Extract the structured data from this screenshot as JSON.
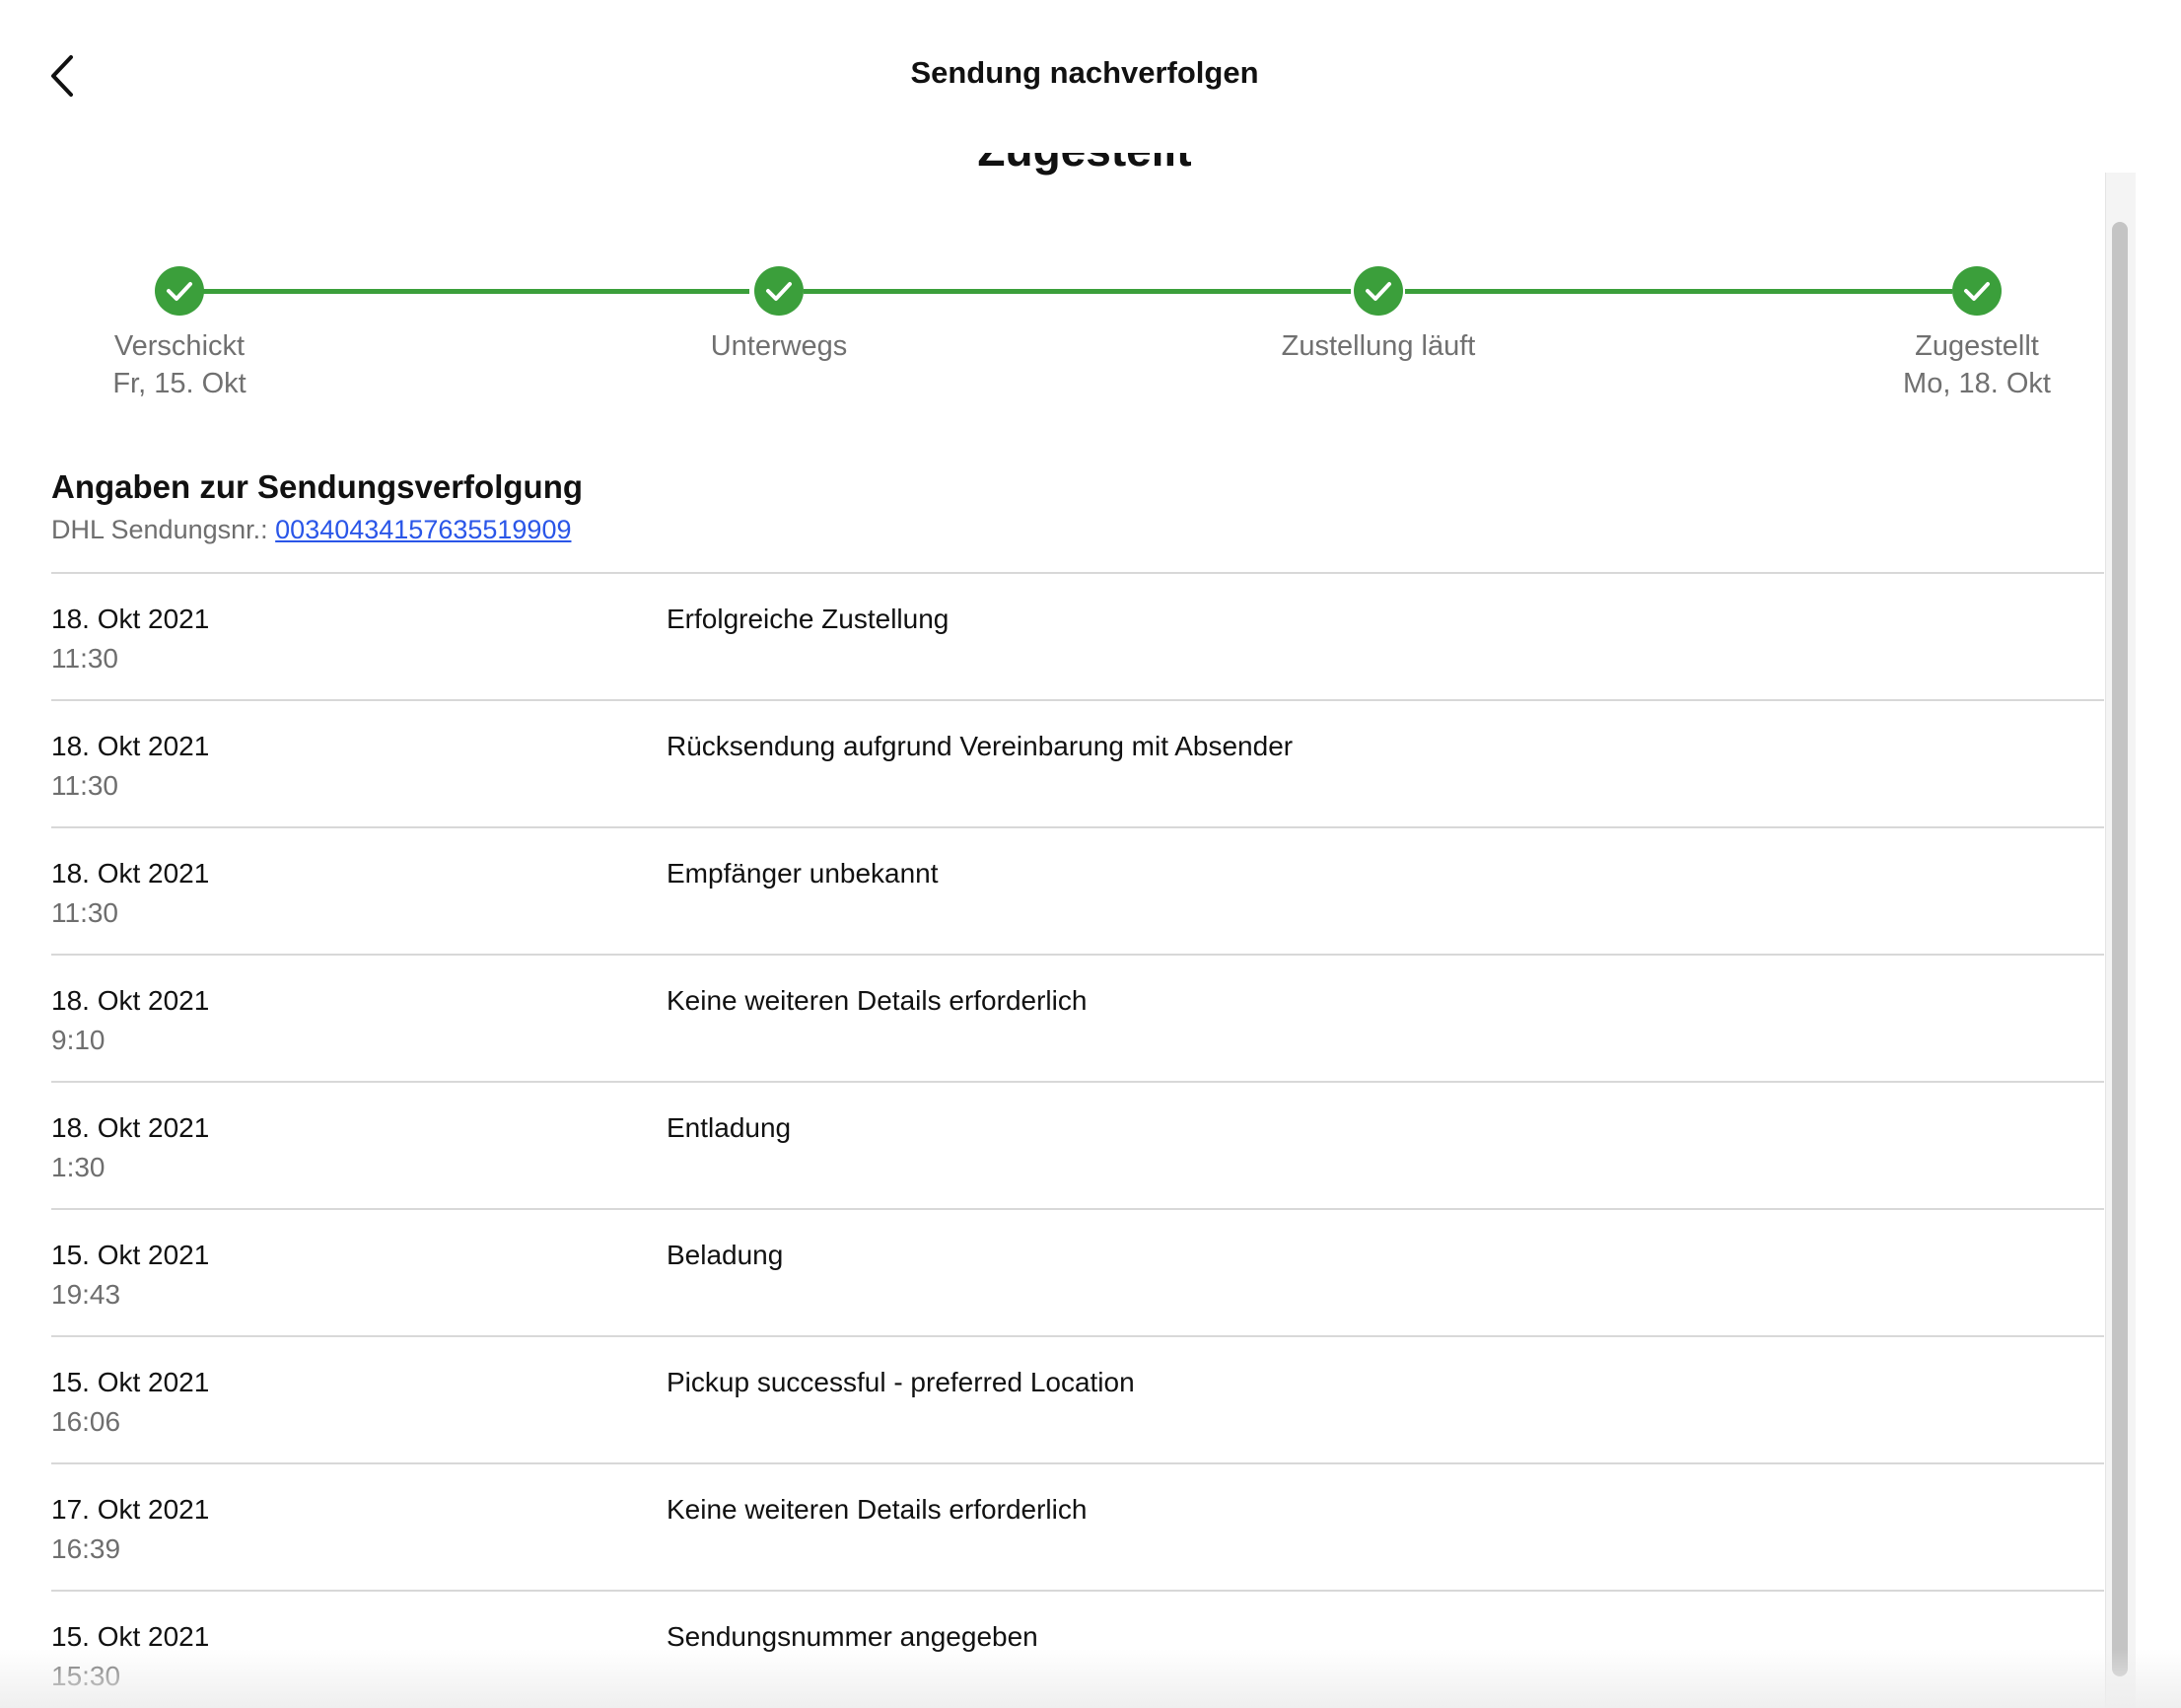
{
  "header": {
    "title": "Sendung nachverfolgen",
    "back_icon": "chevron-left-icon"
  },
  "status": {
    "heading": "Zugestellt"
  },
  "progress": {
    "accent_color": "#3b9f3b",
    "steps": [
      {
        "label": "Verschickt",
        "date": "Fr, 15. Okt",
        "completed": true
      },
      {
        "label": "Unterwegs",
        "date": "",
        "completed": true
      },
      {
        "label": "Zustellung läuft",
        "date": "",
        "completed": true
      },
      {
        "label": "Zugestellt",
        "date": "Mo, 18. Okt",
        "completed": true
      }
    ]
  },
  "tracking": {
    "title": "Angaben zur Sendungsverfolgung",
    "carrier_label": "DHL Sendungsnr.:",
    "tracking_number": "00340434157635519909",
    "link_color": "#2a56e8"
  },
  "events": [
    {
      "date": "18. Okt 2021",
      "time": "11:30",
      "description": "Erfolgreiche Zustellung"
    },
    {
      "date": "18. Okt 2021",
      "time": "11:30",
      "description": "Rücksendung aufgrund Vereinbarung mit Absender"
    },
    {
      "date": "18. Okt 2021",
      "time": "11:30",
      "description": "Empfänger unbekannt"
    },
    {
      "date": "18. Okt 2021",
      "time": "9:10",
      "description": "Keine weiteren Details erforderlich"
    },
    {
      "date": "18. Okt 2021",
      "time": "1:30",
      "description": "Entladung"
    },
    {
      "date": "15. Okt 2021",
      "time": "19:43",
      "description": "Beladung"
    },
    {
      "date": "15. Okt 2021",
      "time": "16:06",
      "description": "Pickup successful - preferred Location"
    },
    {
      "date": "17. Okt 2021",
      "time": "16:39",
      "description": "Keine weiteren Details erforderlich"
    },
    {
      "date": "15. Okt 2021",
      "time": "15:30",
      "description": "Sendungsnummer angegeben"
    }
  ]
}
